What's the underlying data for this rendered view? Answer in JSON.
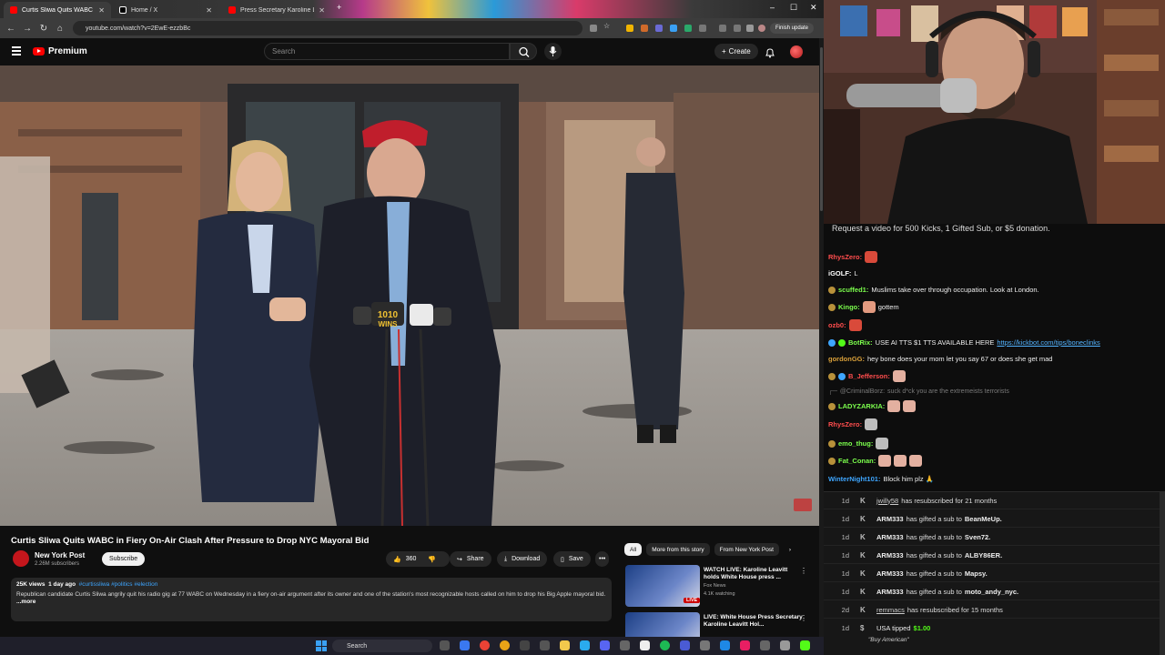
{
  "browser": {
    "tabs": [
      {
        "label": "Curtis Sliwa Quits WABC in Fie",
        "color": "#ff0000"
      },
      {
        "label": "Home / X",
        "color": "#ffffff"
      },
      {
        "label": "Press Secretary Karoline Leavitt",
        "color": "#ff0000"
      }
    ],
    "url": "youtube.com/watch?v=2EwE-ezzbBc",
    "finish_update": "Finish update"
  },
  "youtube": {
    "logo_text": "Premium",
    "search_placeholder": "Search",
    "create_label": "Create",
    "video": {
      "title": "Curtis Sliwa Quits WABC in Fiery On-Air Clash After Pressure to Drop NYC Mayoral Bid",
      "mic_labels": [
        "1010",
        "WINS"
      ]
    },
    "channel": {
      "name": "New York Post",
      "subs": "2.26M subscribers",
      "subscribe_label": "Subscribe"
    },
    "actions": {
      "likes": "360",
      "share": "Share",
      "download": "Download",
      "save": "Save"
    },
    "description": {
      "views": "25K views",
      "age": "1 day ago",
      "tags": "#curtissliwa #politics #election",
      "text": "Republican candidate Curtis Sliwa angrily quit his radio gig at 77 WABC on Wednesday in a fiery on-air argument after its owner and one of the station's most recognizable hosts called on him to drop his Big Apple mayoral bid.",
      "more": "...more"
    },
    "chips": [
      "All",
      "More from this story",
      "From New York Post"
    ],
    "recommendations": [
      {
        "title": "WATCH LIVE: Karoline Leavitt holds White House press ...",
        "channel": "Fox News",
        "meta": "4.1K watching",
        "live": "LIVE"
      },
      {
        "title": "LIVE: White House Press Secretary Karoline Leavitt Hol...",
        "channel": "",
        "meta": "",
        "live": ""
      }
    ]
  },
  "taskbar": {
    "search": "Search"
  },
  "chat": {
    "banner": "Request a video for 500 Kicks, 1 Gifted Sub, or $5 donation.",
    "messages": [
      {
        "user": "RhysZero:",
        "color": "#ff4d4d",
        "text": ""
      },
      {
        "user": "iGOLF:",
        "color": "#ffffff",
        "text": "L"
      },
      {
        "user": "scuffed1:",
        "color": "#7cff4d",
        "text": "Muslims take over through occupation. Look at London."
      },
      {
        "user": "Kingo:",
        "color": "#7cff4d",
        "text": "gottem"
      },
      {
        "user": "ozb0:",
        "color": "#ff4d4d",
        "text": ""
      },
      {
        "user": "BotRix:",
        "color": "#7cff4d",
        "text": "USE AI TTS $1 TTS AVAILABLE HERE",
        "link": "https://kickbot.com/tips/boneclinks"
      },
      {
        "user": "gordonGG:",
        "color": "#d9a03a",
        "text": "hey bone does your mom let you say 67 or does she get mad"
      },
      {
        "user": "B_Jefferson:",
        "color": "#ff4d4d",
        "text": ""
      },
      {
        "user": "@CriminalBorz:",
        "color": "#7a7a7a",
        "text": "suck d*ck you are the extremeists terrorists"
      },
      {
        "user": "LADYZARKIA:",
        "color": "#7cff4d",
        "text": ""
      },
      {
        "user": "RhysZero:",
        "color": "#ff4d4d",
        "text": ""
      },
      {
        "user": "emo_thug:",
        "color": "#7cff4d",
        "text": ""
      },
      {
        "user": "Fat_Conan:",
        "color": "#7cff4d",
        "text": ""
      },
      {
        "user": "WinterNight101:",
        "color": "#3ea6ff",
        "text": "Block him plz 🙏"
      }
    ],
    "events": [
      {
        "age": "1d",
        "user": "jwilly58",
        "link": true,
        "text": "has resubscribed for 21 months",
        "target": ""
      },
      {
        "age": "1d",
        "user": "ARM333",
        "link": false,
        "text": "has gifted a sub to",
        "target": "BeanMeUp."
      },
      {
        "age": "1d",
        "user": "ARM333",
        "link": false,
        "text": "has gifted a sub to",
        "target": "Sven72."
      },
      {
        "age": "1d",
        "user": "ARM333",
        "link": false,
        "text": "has gifted a sub to",
        "target": "ALBY86ER."
      },
      {
        "age": "1d",
        "user": "ARM333",
        "link": false,
        "text": "has gifted a sub to",
        "target": "Mapsy."
      },
      {
        "age": "1d",
        "user": "ARM333",
        "link": false,
        "text": "has gifted a sub to",
        "target": "moto_andy_nyc."
      },
      {
        "age": "2d",
        "user": "remmacs",
        "link": true,
        "text": "has resubscribed for 15 months",
        "target": ""
      },
      {
        "age": "1d",
        "user": "USA tipped",
        "link": false,
        "text": "",
        "target": "$1.00"
      }
    ],
    "event_quote": "\"Buy American\""
  }
}
